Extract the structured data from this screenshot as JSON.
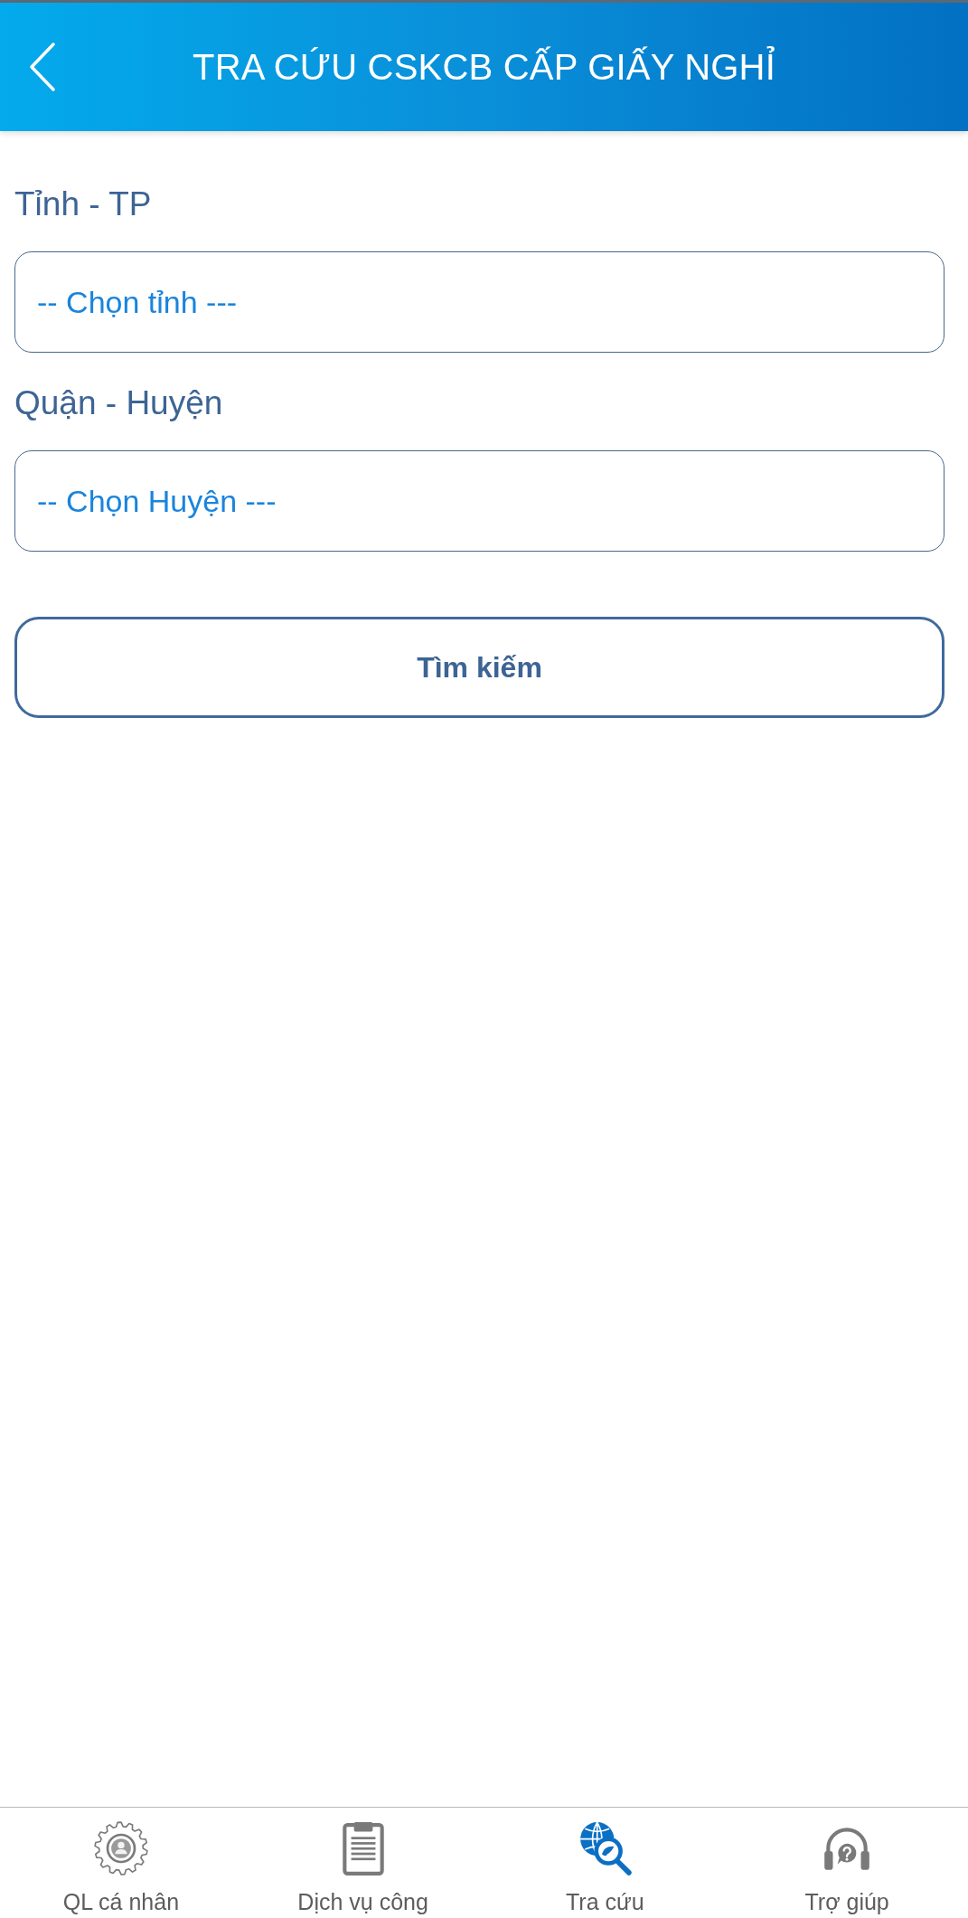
{
  "header": {
    "title": "TRA CỨU CSKCB CẤP GIẤY NGHỈ"
  },
  "form": {
    "fields": [
      {
        "label": "Tỉnh - TP",
        "placeholder": "-- Chọn tỉnh ---"
      },
      {
        "label": "Quận - Huyện",
        "placeholder": "-- Chọn Huyện ---"
      }
    ],
    "search_button": "Tìm kiếm"
  },
  "bottom_nav": [
    {
      "kind": "profile",
      "label": "QL cá nhân",
      "selected": false
    },
    {
      "kind": "services",
      "label": "Dịch vụ công",
      "selected": false
    },
    {
      "kind": "lookup",
      "label": "Tra cứu",
      "selected": true
    },
    {
      "kind": "help",
      "label": "Trợ giúp",
      "selected": false
    }
  ]
}
